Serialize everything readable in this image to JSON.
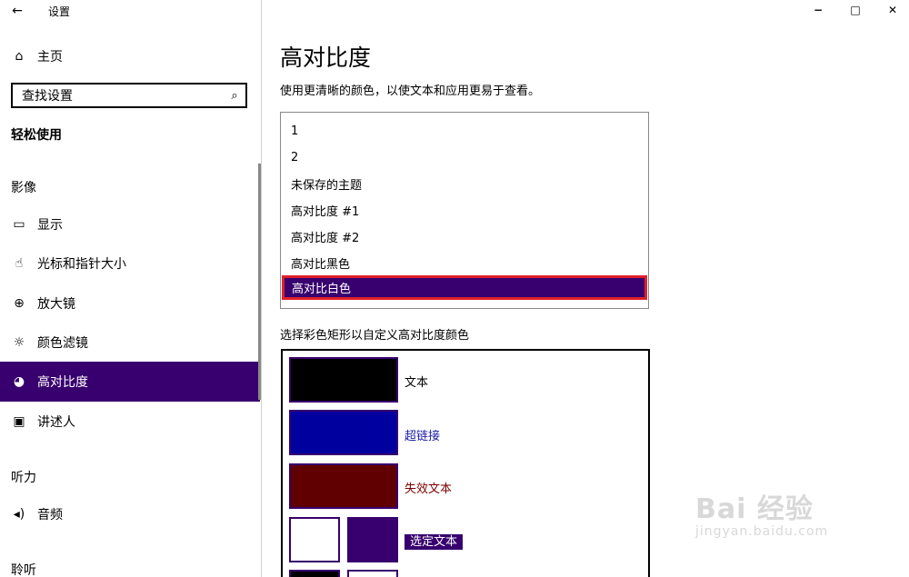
{
  "window": {
    "title": "设置",
    "back_icon": "←",
    "controls": {
      "minimize": "−",
      "maximize": "□",
      "close": "✕"
    }
  },
  "sidebar": {
    "home_label": "主页",
    "search_placeholder": "查找设置",
    "section_title": "轻松使用",
    "groups": [
      {
        "label": "影像"
      },
      {
        "label": "听力"
      },
      {
        "label": "聆听"
      }
    ],
    "items": [
      {
        "label": "显示",
        "icon": "monitor-icon",
        "glyph": "▭"
      },
      {
        "label": "光标和指针大小",
        "icon": "cursor-icon",
        "glyph": "☝"
      },
      {
        "label": "放大镜",
        "icon": "magnifier-icon",
        "glyph": "⊕"
      },
      {
        "label": "颜色滤镜",
        "icon": "sun-icon",
        "glyph": "☼"
      },
      {
        "label": "高对比度",
        "icon": "palette-icon",
        "glyph": "◕",
        "active": true
      },
      {
        "label": "讲述人",
        "icon": "narrator-icon",
        "glyph": "▣"
      },
      {
        "label": "音频",
        "icon": "speaker-icon",
        "glyph": "◂)"
      }
    ],
    "active_color": "#37006e"
  },
  "main": {
    "title": "高对比度",
    "description": "使用更清晰的颜色，以使文本和应用更易于查看。",
    "themes": [
      "1",
      "2",
      "未保存的主题",
      "高对比度 #1",
      "高对比度 #2",
      "高对比黑色",
      "高对比白色"
    ],
    "selected_theme": "高对比白色",
    "color_section_label": "选择彩色矩形以自定义高对比度颜色",
    "swatches": [
      {
        "label": "文本",
        "color": "#000000",
        "label_color": "#000000"
      },
      {
        "label": "超链接",
        "color": "#00009f",
        "label_color": "#1a1aa6"
      },
      {
        "label": "失效文本",
        "color": "#600000",
        "label_color": "#7a0000"
      },
      {
        "label": "选定文本",
        "color_bg": "#ffffff",
        "color_fg": "#37006e"
      }
    ]
  },
  "watermark": {
    "main": "Bai 经验",
    "sub": "jingyan.baidu.com"
  }
}
